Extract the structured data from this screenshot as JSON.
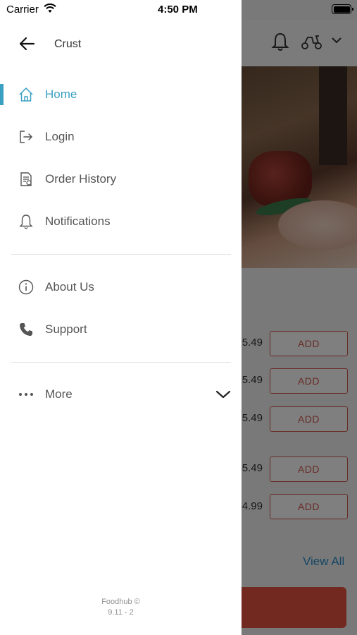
{
  "status_bar": {
    "carrier": "Carrier",
    "time": "4:50 PM"
  },
  "drawer": {
    "store_name": "Crust",
    "menu": [
      {
        "label": "Home",
        "icon": "home-icon",
        "active": true
      },
      {
        "label": "Login",
        "icon": "login-icon"
      },
      {
        "label": "Order History",
        "icon": "order-history-icon"
      },
      {
        "label": "Notifications",
        "icon": "bell-icon"
      }
    ],
    "secondary_menu": [
      {
        "label": "About Us",
        "icon": "info-icon"
      },
      {
        "label": "Support",
        "icon": "phone-icon"
      }
    ],
    "more": {
      "label": "More",
      "icon": "more-dots-icon"
    },
    "footer": {
      "line1": "Foodhub ©",
      "line2": "9.11 - 2"
    },
    "accent_color": "#3aa0c2"
  },
  "background": {
    "items": [
      {
        "price": "5.49",
        "add_label": "ADD"
      },
      {
        "price": "5.49",
        "add_label": "ADD"
      },
      {
        "price": "5.49",
        "add_label": "ADD"
      },
      {
        "price": "5.49",
        "add_label": "ADD"
      },
      {
        "price": "4.99",
        "add_label": "ADD"
      }
    ],
    "view_all": "View All",
    "brand_color": "#d0594c"
  }
}
